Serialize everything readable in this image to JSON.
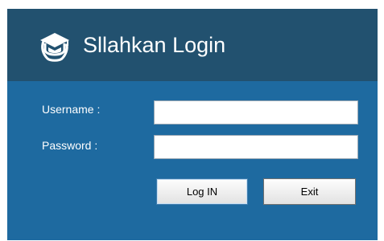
{
  "app": {
    "title": "Sllahkan Login",
    "logo_icon": "graduation-cap-icon",
    "colors": {
      "header": "#22516f",
      "body": "#1e6aa0",
      "text": "#ffffff"
    }
  },
  "form": {
    "username_label": "Username  :",
    "username_value": "",
    "password_label": "Password  :",
    "password_value": ""
  },
  "buttons": {
    "login_label": "Log IN",
    "exit_label": "Exit"
  }
}
